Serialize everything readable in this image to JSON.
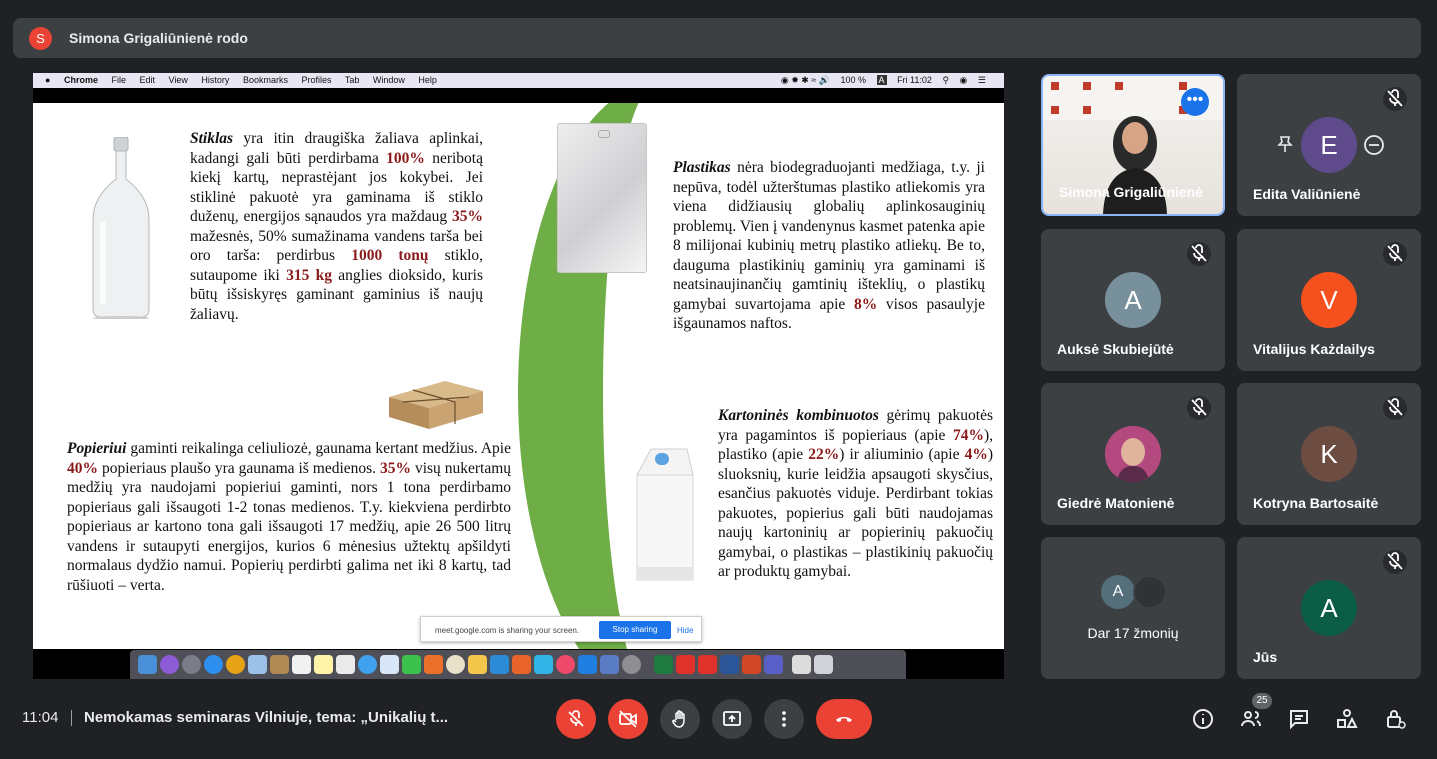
{
  "banner": {
    "avatar_letter": "S",
    "title": "Simona Grigaliūnienė rodo"
  },
  "mac_menu": {
    "apple": "",
    "app": "Chrome",
    "items": [
      "File",
      "Edit",
      "View",
      "History",
      "Bookmarks",
      "Profiles",
      "Tab",
      "Window",
      "Help"
    ],
    "battery": "100 %",
    "clock": "Fri 11:02",
    "input_flag": "A"
  },
  "slide": {
    "p1": {
      "b1": "Stiklas",
      "t1": " yra itin draugiška žaliava aplinkai, kadangi gali būti perdirbama ",
      "r1": "100%",
      "t2": " neribotą kiekį kartų, neprastėjant jos kokybei. Jei stiklinė pakuotė yra gaminama iš stiklo duženų, energijos sąnaudos yra maždaug ",
      "r2": "35%",
      "t3": " mažesnės, 50% sumažinama vandens tarša bei oro tarša: perdirbus ",
      "r3": "1000 tonų",
      "t4": " stiklo, sutaupome iki ",
      "r4": "315 kg",
      "t5": " anglies dioksido, kuris būtų išsiskyręs gaminant gaminius iš naujų žaliavų."
    },
    "p2": {
      "b1": "Plastikas",
      "t1": " nėra biodegraduojanti medžiaga, t.y. ji nepūva, todėl užterštumas plastiko atliekomis yra viena didžiausių globalių aplinkosauginių problemų. Vien į vandenynus kasmet patenka apie 8 milijonai kubinių metrų plastiko atliekų. Be to, dauguma plastikinių gaminių yra gaminami iš neatsinaujinančių gamtinių išteklių, o plastikų gamybai suvartojama apie ",
      "r1": "8%",
      "t2": " visos pasaulyje išgaunamos naftos."
    },
    "p3": {
      "b1": "Popieriui",
      "t1": " gaminti reikalinga celiuliozė, gaunama kertant medžius. Apie ",
      "r1": "40%",
      "t2": " popieriaus plaušo yra gaunama iš medienos. ",
      "r2": "35%",
      "t3": " visų nukertamų medžių yra naudojami popieriui gaminti, nors 1 tona perdirbamo popieriaus gali išsaugoti 1-2 tonas medienos. T.y. kiekviena perdirbto popieriaus ar kartono tona gali išsaugoti 17 medžių, apie 26 500 litrų vandens ir sutaupyti energijos, kurios 6 mėnesius užtektų apšildyti normalaus dydžio namui. Popierių perdirbti galima net iki 8 kartų, tad rūšiuoti – verta."
    },
    "p4": {
      "b1": "Kartoninės kombinuotos",
      "t1": " gėrimų pakuotės yra pagamintos iš popieriaus (apie ",
      "r1": "74%",
      "t2": "), plastiko (apie ",
      "r2": "22%",
      "t3": ") ir aliuminio (apie ",
      "r3": "4%",
      "t4": ") sluoksnių, kurie leidžia apsaugoti skysčius, esančius pakuotės viduje. Perdirbant tokias pakuotes, popierius gali būti naudojamas naujų kartoninių ar popierinių pakuočių gamybai, o plastikas – plastikinių pakuočių ar produktų gamybai."
    }
  },
  "share_toast": {
    "message": "meet.google.com is sharing your screen.",
    "stop": "Stop sharing",
    "hide": "Hide"
  },
  "tiles": [
    {
      "name": "Simona Grigaliūnienė"
    },
    {
      "name": "Edita Valiūnienė",
      "avatar_letter": "E",
      "avatar_color": "#5f4b8b"
    },
    {
      "name": "Auksė Skubiejūtė",
      "avatar_letter": "A",
      "avatar_color": "#78909c"
    },
    {
      "name": "Vitalijus Każdailys",
      "avatar_letter": "V",
      "avatar_color": "#f4511e"
    },
    {
      "name": "Giedrė Matonienė"
    },
    {
      "name": "Kotryna Bartosaitė",
      "avatar_letter": "K",
      "avatar_color": "#6d4c41"
    },
    {
      "name": "Dar 17 žmonių",
      "avatar_letter": "A",
      "avatar_color": "#546e7a"
    },
    {
      "name": "Jūs",
      "avatar_letter": "A",
      "avatar_color": "#0b5d45"
    }
  ],
  "controls": {
    "time": "11:04",
    "meeting_title": "Nemokamas seminaras Vilniuje, tema: „Unikalių t...",
    "participants_count": "25"
  },
  "colors": {
    "accent_red": "#ea4335",
    "slide_green": "#6fad47",
    "highlight_red": "#8b1a1a",
    "meet_blue": "#1a73e8"
  }
}
